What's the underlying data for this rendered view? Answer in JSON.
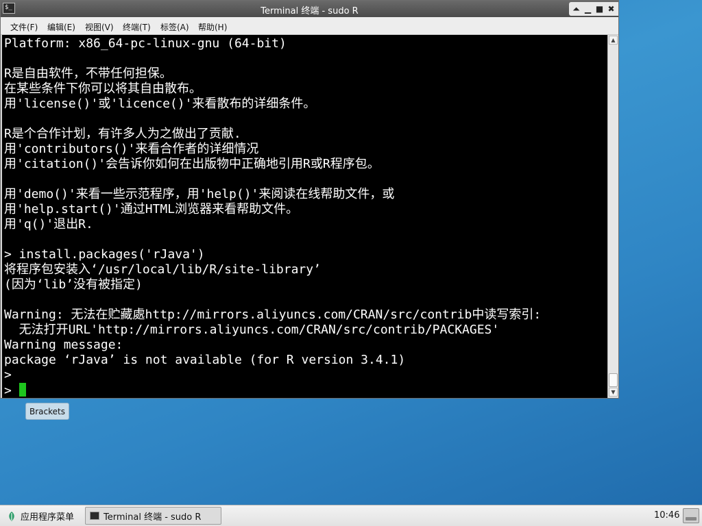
{
  "window": {
    "title": "Terminal 终端 - sudo R",
    "controls": [
      "⏶",
      "▁",
      "■",
      "✖"
    ]
  },
  "menubar": {
    "items": [
      {
        "label": "文件(F)"
      },
      {
        "label": "编辑(E)"
      },
      {
        "label": "视图(V)"
      },
      {
        "label": "终端(T)"
      },
      {
        "label": "标签(A)"
      },
      {
        "label": "帮助(H)"
      }
    ]
  },
  "terminal": {
    "lines": [
      "Platform: x86_64-pc-linux-gnu (64-bit)",
      "",
      "R是自由软件，不带任何担保。",
      "在某些条件下你可以将其自由散布。",
      "用'license()'或'licence()'来看散布的详细条件。",
      "",
      "R是个合作计划，有许多人为之做出了贡献.",
      "用'contributors()'来看合作者的详细情况",
      "用'citation()'会告诉你如何在出版物中正确地引用R或R程序包。",
      "",
      "用'demo()'来看一些示范程序，用'help()'来阅读在线帮助文件，或",
      "用'help.start()'通过HTML浏览器来看帮助文件。",
      "用'q()'退出R.",
      "",
      "> install.packages('rJava')",
      "将程序包安装入‘/usr/local/lib/R/site-library’",
      "(因为‘lib’没有被指定)",
      "",
      "Warning: 无法在贮藏處http://mirrors.aliyuncs.com/CRAN/src/contrib中读写索引:",
      "  无法打开URL'http://mirrors.aliyuncs.com/CRAN/src/contrib/PACKAGES'",
      "Warning message:",
      "package ‘rJava’ is not available (for R version 3.4.1)",
      ">"
    ],
    "prompt": "> "
  },
  "tooltip": {
    "text": "Brackets"
  },
  "taskbar": {
    "apps_menu_label": "应用程序菜单",
    "task_label": "Terminal 终端 - sudo R",
    "clock": "10:46"
  }
}
